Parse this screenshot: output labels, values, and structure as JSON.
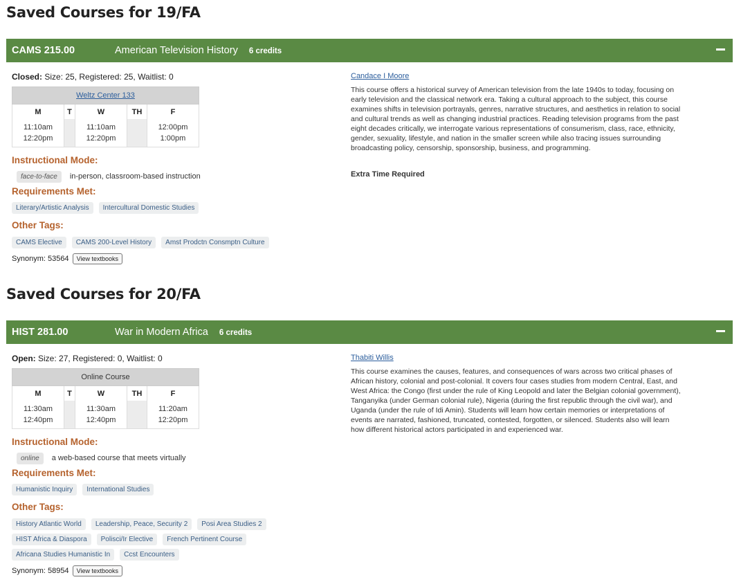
{
  "sections": [
    {
      "title": "Saved Courses for 19/FA",
      "course": {
        "code": "CAMS 215.00",
        "title": "American Television History",
        "credits": "6 credits",
        "status_label": "Closed:",
        "status_text": " Size: 25, Registered: 25, Waitlist: 0",
        "location": "Weltz Center 133",
        "days": [
          "M",
          "T",
          "W",
          "TH",
          "F"
        ],
        "times": [
          {
            "start": "11:10am",
            "end": "12:20pm"
          },
          {
            "start": "",
            "end": ""
          },
          {
            "start": "11:10am",
            "end": "12:20pm"
          },
          {
            "start": "",
            "end": ""
          },
          {
            "start": "12:00pm",
            "end": "1:00pm"
          }
        ],
        "instructional_mode_label": "Instructional Mode:",
        "mode_tag": "face-to-face",
        "mode_desc": "in-person, classroom-based instruction",
        "requirements_label": "Requirements Met:",
        "requirements": [
          "Literary/Artistic Analysis",
          "Intercultural Domestic Studies"
        ],
        "other_tags_label": "Other Tags:",
        "other_tags": [
          "CAMS Elective",
          "CAMS 200-Level History",
          "Amst Prodctn Consmptn Culture"
        ],
        "synonym": "Synonym: 53564",
        "textbook_button": "View textbooks",
        "instructor": "Candace I Moore",
        "description": "This course offers a historical survey of American television from the late 1940s to today, focusing on early television and the classical network era. Taking a cultural approach to the subject, this course examines shifts in television portrayals, genres, narrative structures, and aesthetics in relation to social and cultural trends as well as changing industrial practices. Reading television programs from the past eight decades critically, we interrogate various representations of consumerism, class, race, ethnicity, gender, sexuality, lifestyle, and nation in the smaller screen while also tracing issues surrounding broadcasting policy, censorship, sponsorship, business, and programming.",
        "extra_note": "Extra Time Required"
      }
    },
    {
      "title": "Saved Courses for 20/FA",
      "course": {
        "code": "HIST 281.00",
        "title": "War in Modern Africa",
        "credits": "6 credits",
        "status_label": "Open:",
        "status_text": " Size: 27, Registered: 0, Waitlist: 0",
        "location": "Online Course",
        "days": [
          "M",
          "T",
          "W",
          "TH",
          "F"
        ],
        "times": [
          {
            "start": "11:30am",
            "end": "12:40pm"
          },
          {
            "start": "",
            "end": ""
          },
          {
            "start": "11:30am",
            "end": "12:40pm"
          },
          {
            "start": "",
            "end": ""
          },
          {
            "start": "11:20am",
            "end": "12:20pm"
          }
        ],
        "instructional_mode_label": "Instructional Mode:",
        "mode_tag": "online",
        "mode_desc": "a web-based course that meets virtually",
        "requirements_label": "Requirements Met:",
        "requirements": [
          "Humanistic Inquiry",
          "International Studies"
        ],
        "other_tags_label": "Other Tags:",
        "other_tags": [
          "History Atlantic World",
          "Leadership, Peace, Security 2",
          "Posi Area Studies 2",
          "HIST Africa & Diaspora",
          "Polisci/Ir Elective",
          "French Pertinent Course",
          "Africana Studies Humanistic In",
          "Ccst Encounters"
        ],
        "synonym": "Synonym: 58954",
        "textbook_button": "View textbooks",
        "instructor": "Thabiti Willis",
        "description": "This course examines the causes, features, and consequences of wars across two critical phases of African history, colonial and post-colonial. It covers four cases studies from modern Central, East, and West Africa: the Congo (first under the rule of King Leopold and later the Belgian colonial government), Tanganyika (under German colonial rule), Nigeria (during the first republic through the civil war), and Uganda (under the rule of Idi Amin). Students will learn how certain memories or interpretations of events are narrated, fashioned, truncated, contested, forgotten, or silenced. Students also will learn how different historical actors participated in and experienced war."
      }
    }
  ]
}
